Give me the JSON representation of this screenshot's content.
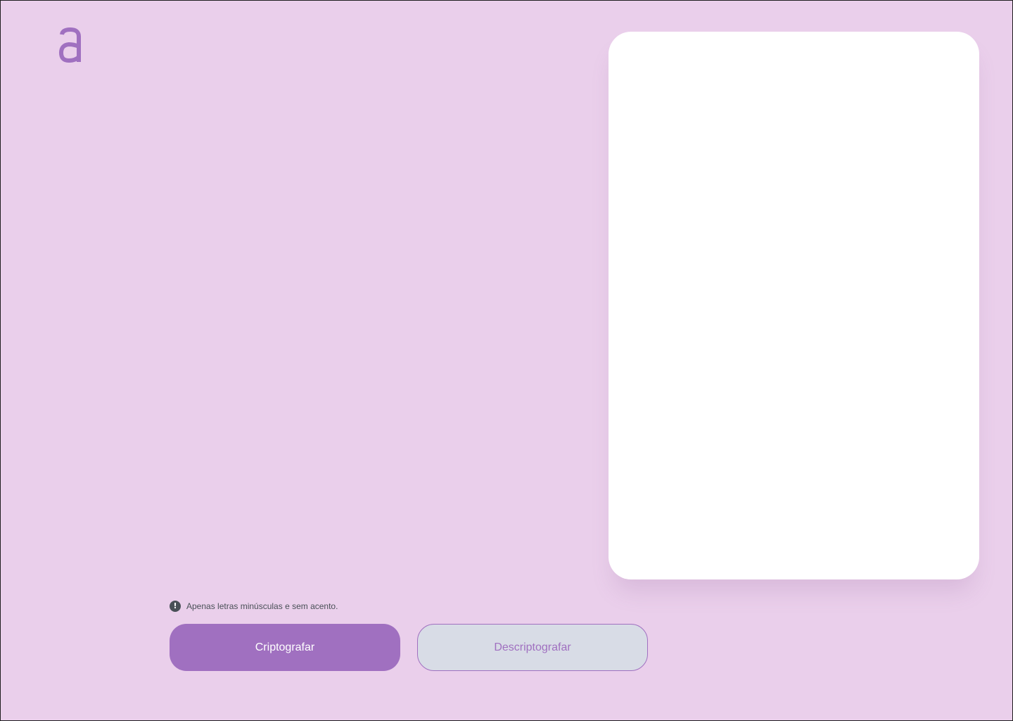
{
  "app": {
    "logo_icon": "a-letter-logo-icon",
    "accent_color": "#a070c0",
    "background_color": "#eacfeb"
  },
  "input": {
    "value": "",
    "placeholder": ""
  },
  "hint": {
    "icon": "exclamation-circle-icon",
    "text": "Apenas letras minúsculas e sem acento."
  },
  "buttons": {
    "encrypt_label": "Criptografar",
    "decrypt_label": "Descriptografar"
  },
  "output": {
    "text": ""
  }
}
